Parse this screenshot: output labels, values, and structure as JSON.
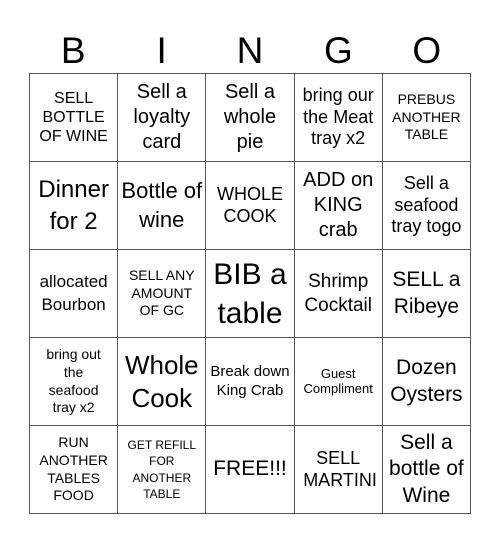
{
  "header": {
    "letters": [
      "B",
      "I",
      "N",
      "G",
      "O"
    ]
  },
  "cells": [
    {
      "text": "SELL BOTTLE OF WINE"
    },
    {
      "text": "Sell a loyalty card"
    },
    {
      "text": "Sell a whole pie"
    },
    {
      "text": "bring our the Meat tray x2"
    },
    {
      "text": "PREBUS ANOTHER TABLE"
    },
    {
      "text": "Dinner for 2"
    },
    {
      "text": "Bottle of wine"
    },
    {
      "text": "WHOLE COOK"
    },
    {
      "text": "ADD on KING crab"
    },
    {
      "text": "Sell a seafood tray togo"
    },
    {
      "text": "allocated Bourbon"
    },
    {
      "text": "SELL ANY AMOUNT OF GC"
    },
    {
      "text": "BIB a table"
    },
    {
      "text": "Shrimp Cocktail"
    },
    {
      "text": "SELL a Ribeye"
    },
    {
      "text": "bring out the seafood tray x2"
    },
    {
      "text": "Whole Cook"
    },
    {
      "text": "Break down King Crab"
    },
    {
      "text": "Guest Compliment"
    },
    {
      "text": "Dozen Oysters"
    },
    {
      "text": "RUN ANOTHER TABLES FOOD"
    },
    {
      "text": "GET REFILL FOR ANOTHER TABLE"
    },
    {
      "text": "FREE!!!"
    },
    {
      "text": "SELL MARTINI"
    },
    {
      "text": "Sell a bottle of Wine"
    }
  ]
}
